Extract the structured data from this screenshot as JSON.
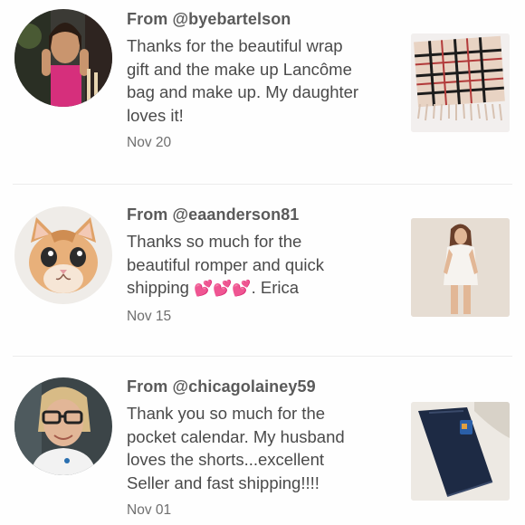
{
  "items": [
    {
      "from": "From @byebartelson",
      "message": "Thanks for the beautiful wrap\ngift and the make up Lancôme\nbag and make up. My daughter\nloves it!",
      "date": "Nov 20",
      "avatar": "woman-avatar",
      "thumbnail": "plaid-scarf-image"
    },
    {
      "from": "From @eaanderson81",
      "message_line1": "Thanks so much for the",
      "message_line2": "beautiful romper and quick",
      "message_line3_start": "shipping ",
      "hearts": "💕💕💕",
      "message_line3_end": ". Erica",
      "date": "Nov 15",
      "avatar": "kitten-avatar",
      "thumbnail": "white-romper-image"
    },
    {
      "from": "From @chicagolainey59",
      "message": "Thank you so much for the\npocket calendar. My husband\nloves the shorts...excellent\nSeller and fast shipping!!!!",
      "date": "Nov 01",
      "avatar": "woman-glasses-avatar",
      "thumbnail": "denim-shorts-image"
    }
  ],
  "colors": {
    "heart": "#e8449c",
    "text": "#4a4a4a",
    "divider": "#ececec"
  }
}
